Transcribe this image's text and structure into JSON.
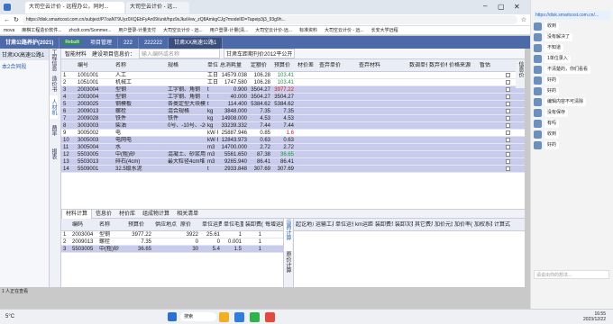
{
  "browser": {
    "tabs": [
      "大司空云计价 - 远程办公，同时...",
      "大司空云计价 - 远..."
    ],
    "url": "https://disk.smartcost.com.cn/subject/P7oaNT9Uyz0XQEbFyAn09/unit/hpz9sJkaVew_zQ8AmkgCJg?modelID=Tapeip3j3_93g9h...",
    "bookmarks": [
      "mova",
      "麻棋工程造价软件...",
      "zhcdt.com/Sommer...",
      "用户登录-计量支付",
      "大司空云计价 - 远...",
      "用户登录-计量(清...",
      "大司空云计价-远...",
      "标准资料",
      "大司空云计价 - 远...",
      "长安大学远程",
      "造价管理-甘肃省"
    ]
  },
  "app": {
    "title": "甘肃公路养护(2021)",
    "badge": "Rebuilt",
    "tabs": [
      "项目管理",
      "222",
      "222222",
      "甘肃XX高速公路1"
    ]
  },
  "left_panel": {
    "items": [
      "甘肃XX高速公路1",
      "本2合同段"
    ],
    "footer": "1 人正在查看"
  },
  "vertical_nav": [
    "工程信息",
    "造价书",
    "人材机",
    "费率",
    "报表"
  ],
  "toolbar": {
    "items": [
      "智能材料",
      "建设项目信息价：",
      "输入编码或名称",
      "甘肃车距期刊价2012平公开"
    ],
    "side_label": "信息价"
  },
  "material_table": {
    "headers": [
      "编号",
      "名称",
      "规格",
      "单位",
      "总消耗量",
      "定额价",
      "预算价",
      "材价差",
      "查弃单价",
      "查弃材料",
      "数调单价",
      "数弃价格",
      "价格来源",
      "暂估"
    ],
    "rows": [
      [
        "1",
        "1001001",
        "人工",
        "",
        "工日",
        "14579.038",
        "106.28",
        "103.41",
        ""
      ],
      [
        "2",
        "1051001",
        "机械工",
        "",
        "工日",
        "1747.580",
        "106.28",
        "103.41",
        ""
      ],
      [
        "3",
        "2003004",
        "型钢",
        "工字钢、角钢",
        "t",
        "0.900",
        "3504.27",
        "3977.22",
        ""
      ],
      [
        "4",
        "2003004",
        "型钢",
        "工字钢、角钢",
        "t",
        "40.000",
        "3504.27",
        "3504.27",
        ""
      ],
      [
        "5",
        "2003025",
        "钢模板",
        "各类定型大块模板",
        "t",
        "114.400",
        "5384.62",
        "5384.62",
        ""
      ],
      [
        "6",
        "2009013",
        "螺栓",
        "混合规格",
        "kg",
        "3848.000",
        "7.35",
        "7.35",
        ""
      ],
      [
        "7",
        "2009028",
        "铁件",
        "铁件",
        "kg",
        "14908.000",
        "4.53",
        "4.53",
        ""
      ],
      [
        "8",
        "3003003",
        "柴油",
        "0号、-10号、-20号",
        "kg",
        "33239.332",
        "7.44",
        "7.44",
        ""
      ],
      [
        "9",
        "3005002",
        "电",
        "",
        "kW·h",
        "25887.946",
        "0.85",
        "1.6",
        ""
      ],
      [
        "10",
        "3005003",
        "电网电",
        "",
        "kW·h",
        "12843.973",
        "0.63",
        "0.63",
        ""
      ],
      [
        "11",
        "3005004",
        "水",
        "",
        "m3",
        "14700.000",
        "2.72",
        "2.72",
        ""
      ],
      [
        "12",
        "5503005",
        "中(粗)砂",
        "混凝土、砂浆用堆...",
        "m3",
        "5561.650",
        "87.38",
        "36.65",
        ""
      ],
      [
        "13",
        "5503013",
        "碎石(4cm)",
        "最大粒径4cm堆方",
        "m3",
        "9265.940",
        "86.41",
        "86.41",
        ""
      ],
      [
        "14",
        "5509001",
        "32.5级水泥",
        "",
        "t",
        "2933.848",
        "307.69",
        "307.69",
        ""
      ]
    ]
  },
  "bottom_tabs": [
    "材料计算",
    "信息价",
    "材价库",
    "组成物计算",
    "相关清单"
  ],
  "bottom_table": {
    "headers": [
      "",
      "编码",
      "名称",
      "预算价",
      "供应地点",
      "原价",
      "单位运费",
      "单位毛重(t)",
      "装卸费(元)",
      "每增运距"
    ],
    "rows": [
      [
        "1",
        "2003004",
        "型钢",
        "3977.22",
        "",
        "3922",
        "25.61",
        "1",
        "1"
      ],
      [
        "2",
        "2009013",
        "螺栓",
        "7.35",
        "",
        "0",
        "0",
        "0.001",
        "1"
      ],
      [
        "3",
        "5503005",
        "中(粗)砂",
        "36.65",
        "",
        "30",
        "5.4",
        "1.5",
        "1"
      ]
    ]
  },
  "bottom_side_tabs": [
    "运费计算",
    "原价计算"
  ],
  "bottom_right_headers": [
    "起讫地点",
    "运输工具",
    "单位运价",
    "km运距",
    "装卸费单价",
    "装卸次数",
    "其它费用",
    "加价元比",
    "加价率(%)",
    "加权系数",
    "计算式"
  ],
  "chat": {
    "link": "https://disk.smartcost.com.cn/...",
    "messages": [
      "收到",
      "没有解决了",
      "不知道",
      "1单位录入",
      "不清楚的，你们看看",
      "好的",
      "好的",
      "编辑内容不可清除",
      "没有保存",
      "有吗",
      "收到",
      "好的"
    ],
    "input_placeholder": "请说出你的想法..."
  },
  "taskbar": {
    "time": "16:55",
    "date": "2023/12/22",
    "search": "搜索",
    "weather": "5°C"
  },
  "colors": {
    "highlight_row": "#c8cbec",
    "app_tab_bar": "#4d6aa8",
    "green_value": "#1a9a3a",
    "red_value": "#d11a1a"
  }
}
